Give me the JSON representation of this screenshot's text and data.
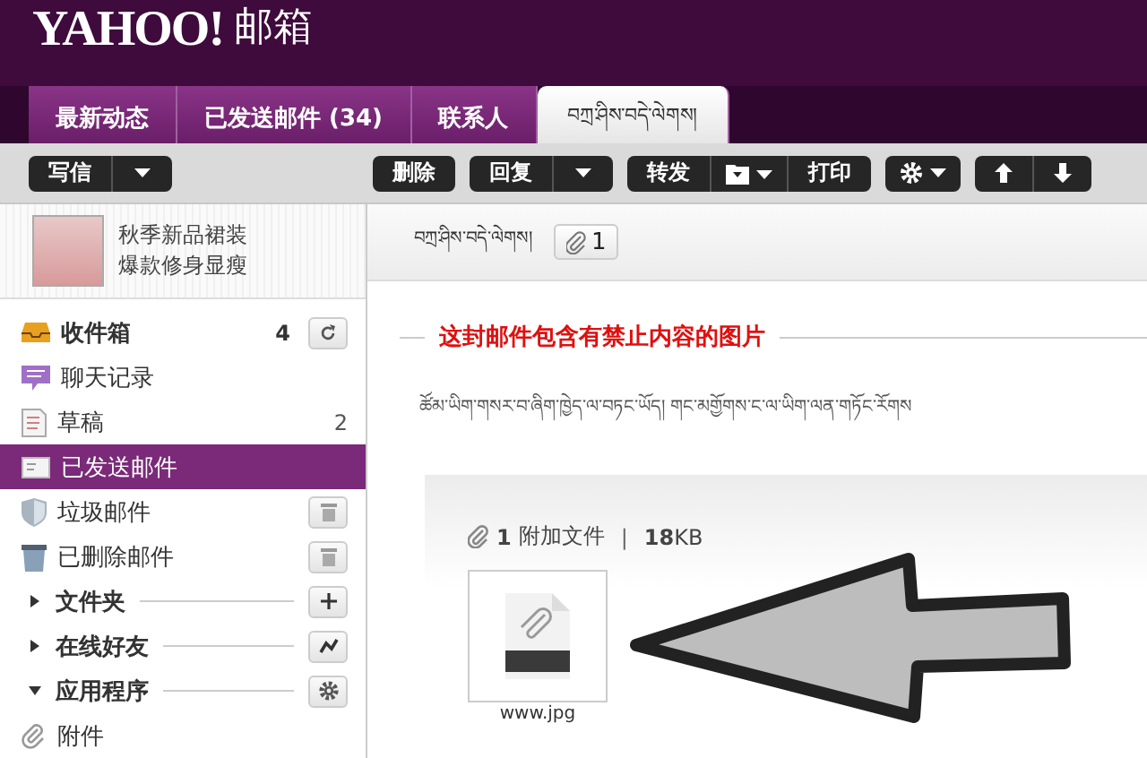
{
  "header": {
    "logo": "YAHOO!",
    "product": "邮箱"
  },
  "tabs": [
    {
      "label": "最新动态",
      "selected": false
    },
    {
      "label": "已发送邮件 (34)",
      "selected": false
    },
    {
      "label": "联系人",
      "selected": false
    },
    {
      "label": "བཀྲ་ཤིས་བདེ་ལེགས།",
      "selected": true
    }
  ],
  "toolbar": [
    {
      "buttons": [
        {
          "kind": "text",
          "label": "写信"
        },
        {
          "kind": "caret"
        }
      ]
    },
    {
      "buttons": [
        {
          "kind": "text",
          "label": "删除"
        }
      ]
    },
    {
      "buttons": [
        {
          "kind": "text",
          "label": "回复"
        },
        {
          "kind": "caret"
        }
      ]
    },
    {
      "buttons": [
        {
          "kind": "text",
          "label": "转发"
        },
        {
          "kind": "folder"
        },
        {
          "kind": "text",
          "label": "打印"
        }
      ]
    },
    {
      "buttons": [
        {
          "kind": "gear"
        }
      ]
    },
    {
      "buttons": [
        {
          "kind": "up"
        },
        {
          "kind": "down"
        }
      ]
    }
  ],
  "sidebar": {
    "ad": {
      "line_1": "秋季新品裙装",
      "line_2": "爆款修身显瘦"
    },
    "items": [
      {
        "kind": "folder",
        "label": "收件箱",
        "count": "4",
        "unread": true,
        "selected": false
      },
      {
        "kind": "folder",
        "label": "聊天记录",
        "unread": false,
        "selected": false
      },
      {
        "kind": "folder",
        "label": "草稿",
        "count": "2",
        "unread": false,
        "selected": false
      },
      {
        "kind": "folder",
        "label": "已发送邮件",
        "unread": false,
        "selected": true
      },
      {
        "kind": "folder",
        "label": "垃圾邮件",
        "unread": false,
        "selected": false
      },
      {
        "kind": "folder",
        "label": "已删除邮件",
        "unread": false,
        "selected": false
      },
      {
        "kind": "section",
        "label": "文件夹",
        "expanded": false
      },
      {
        "kind": "section",
        "label": "在线好友",
        "expanded": false
      },
      {
        "kind": "section",
        "label": "应用程序",
        "expanded": true
      },
      {
        "kind": "folder",
        "label": "附件",
        "unread": false,
        "selected": false
      }
    ]
  },
  "message": {
    "subject": "བཀྲ་ཤིས་བདེ་ལེགས།",
    "attachment_count": "1",
    "warning": "这封邮件包含有禁止内容的图片",
    "body": "ཚོམ་ཡིག་གསར་བ་ཞིག་ཁྱེད་ལ་བཏང་ཡོད།  གང་མགྱོགས་ང་ལ་ཡིག་ལན་གཏོང་རོགས",
    "attachments": {
      "count": "1",
      "label": "附加文件",
      "separator": "|",
      "size": "**18**KB",
      "files": [
        {
          "name": "www.jpg"
        }
      ]
    }
  }
}
